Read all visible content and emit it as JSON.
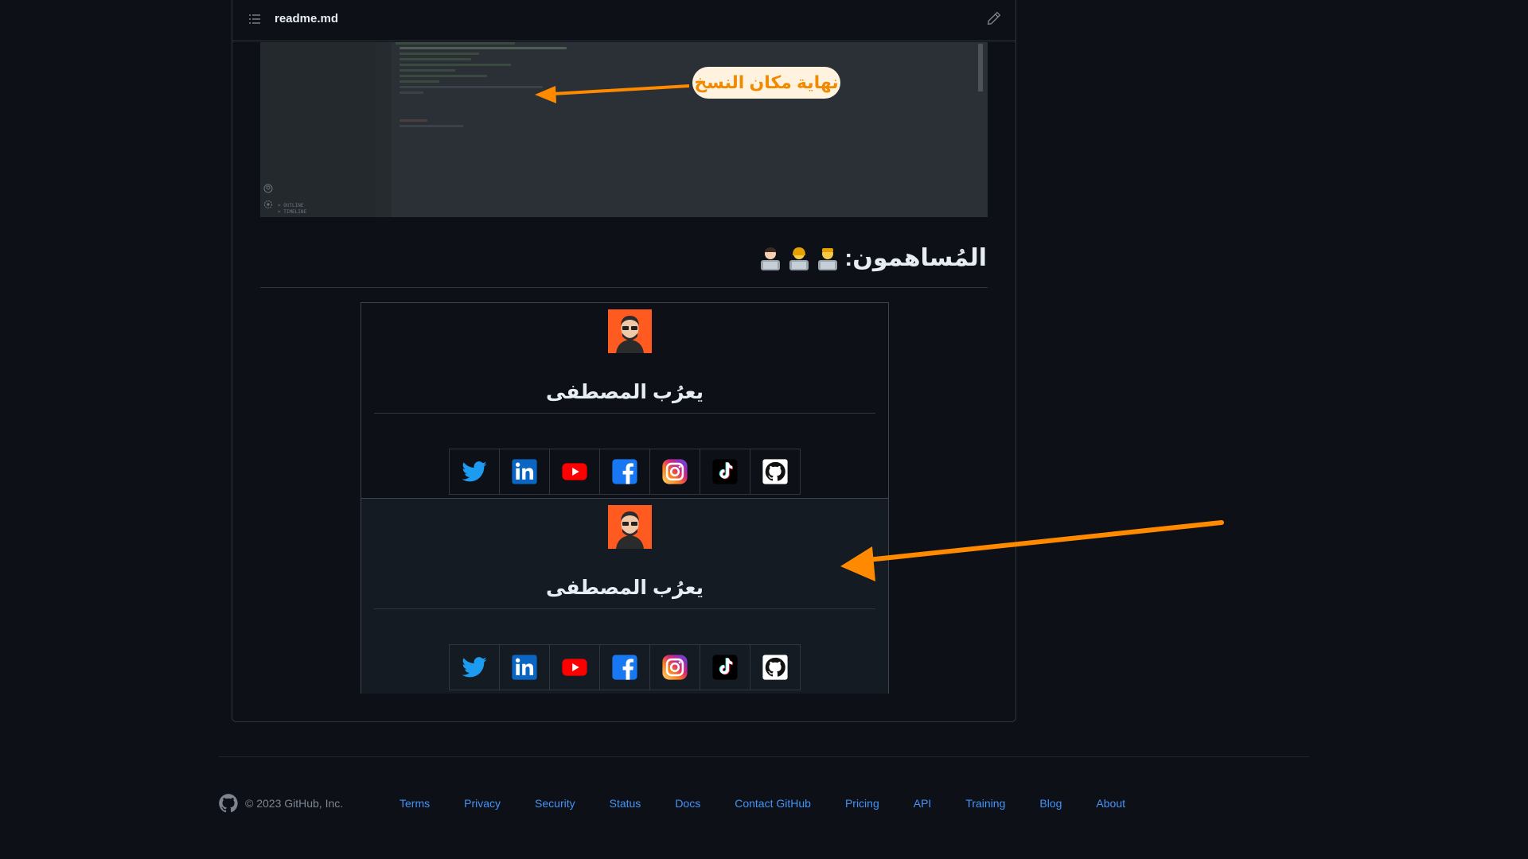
{
  "readme": {
    "filename": "readme.md"
  },
  "editor_callout": "نهاية مكان النسخ",
  "editor_sidebar": [
    "> OUTLINE",
    "> TIMELINE"
  ],
  "contributors_heading": "المُساهمون:",
  "contributors": [
    {
      "name": "يعرُب المصطفى"
    },
    {
      "name": "يعرُب المصطفى"
    }
  ],
  "social_icons": [
    "twitter-icon",
    "linkedin-icon",
    "youtube-icon",
    "facebook-icon",
    "instagram-icon",
    "tiktok-icon",
    "github-icon"
  ],
  "colors": {
    "background": "#0d1117",
    "link": "#4493f8",
    "annotation": "#ff8a00",
    "avatar_bg": "#ff5a1f"
  },
  "footer": {
    "copyright": "© 2023 GitHub, Inc.",
    "links": [
      "Terms",
      "Privacy",
      "Security",
      "Status",
      "Docs",
      "Contact GitHub",
      "Pricing",
      "API",
      "Training",
      "Blog",
      "About"
    ]
  }
}
